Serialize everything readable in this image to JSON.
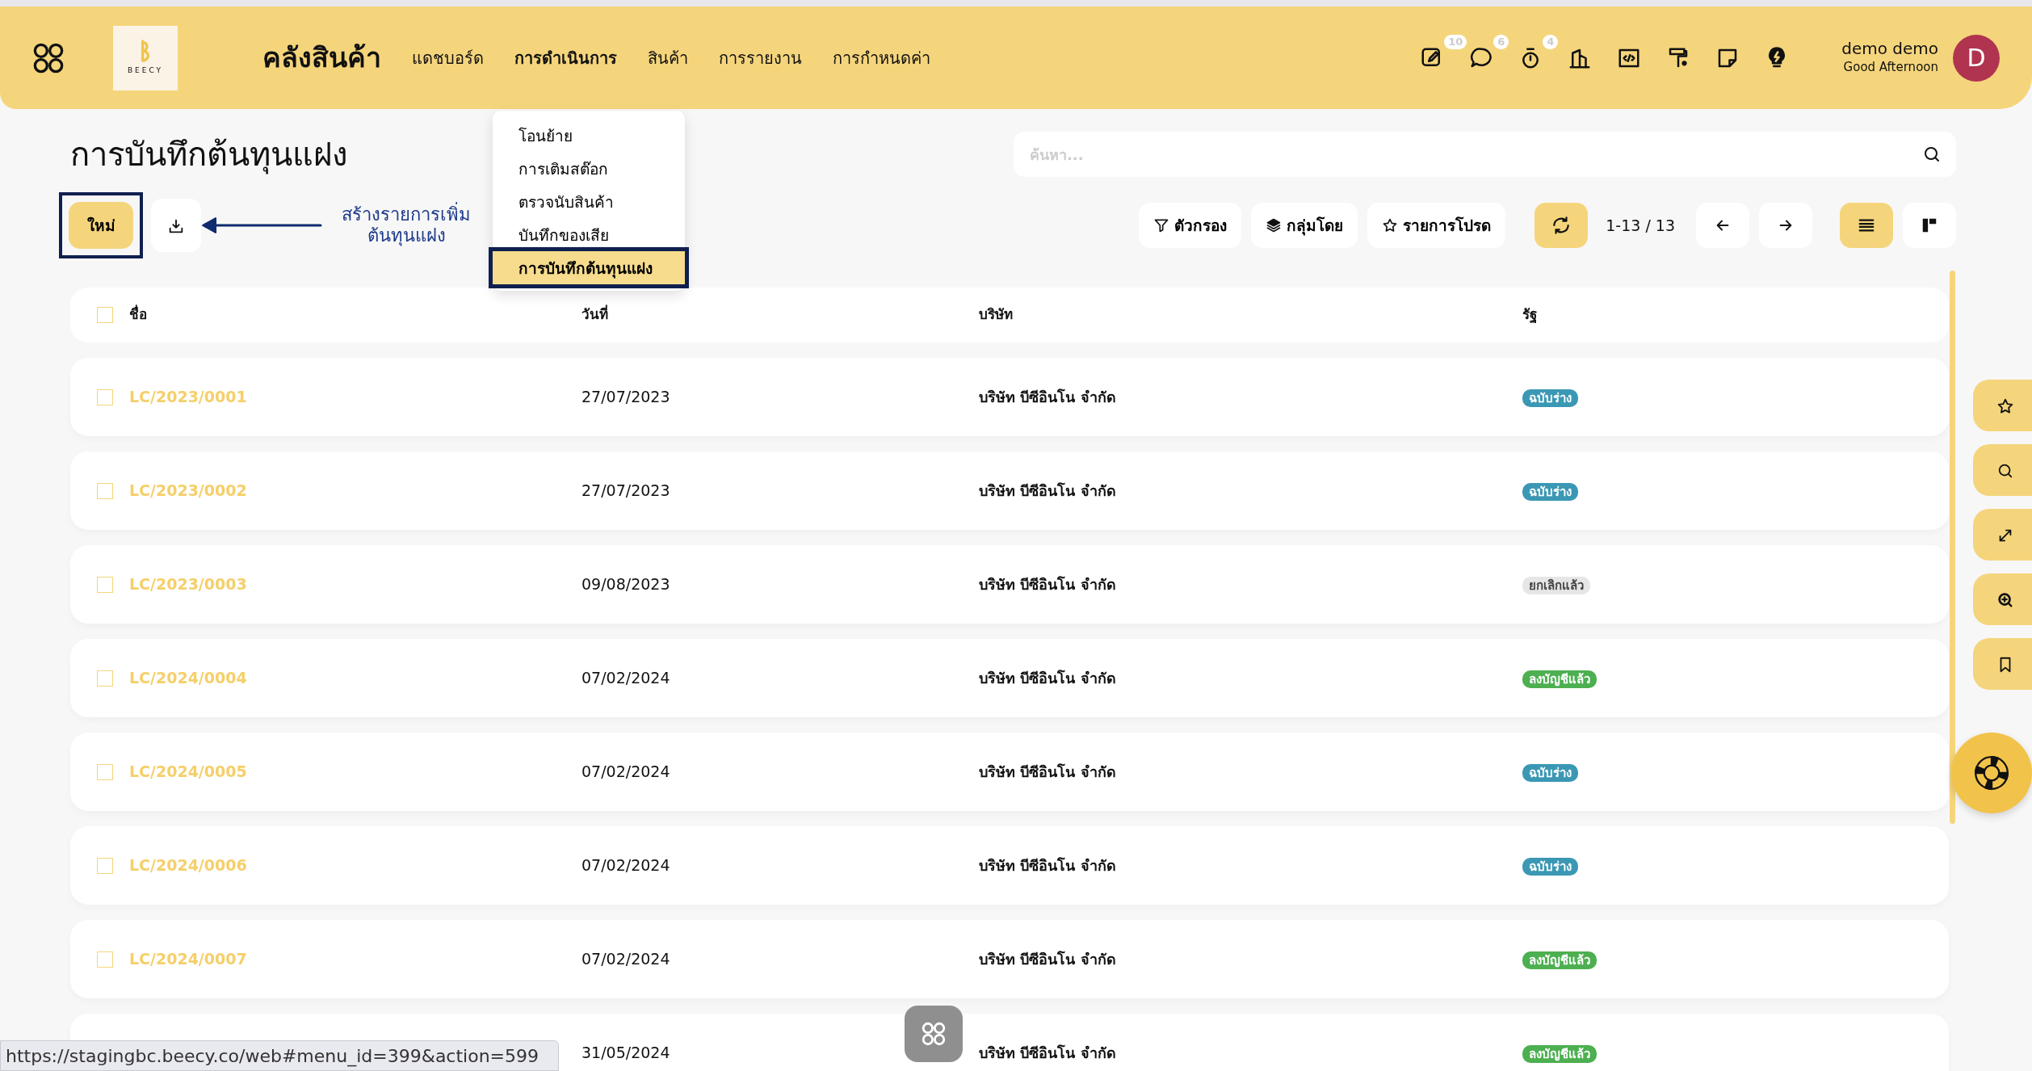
{
  "header": {
    "app_title": "คลังสินค้า",
    "logo_text": "BEECY",
    "menu": [
      {
        "label": "แดชบอร์ด",
        "open": false
      },
      {
        "label": "การดำเนินการ",
        "open": true
      },
      {
        "label": "สินค้า",
        "open": false
      },
      {
        "label": "การรายงาน",
        "open": false
      },
      {
        "label": "การกำหนดค่า",
        "open": false
      }
    ],
    "icons": [
      {
        "kind": "edit",
        "badge": "10"
      },
      {
        "kind": "chat",
        "badge": "6"
      },
      {
        "kind": "timer",
        "badge": "4"
      },
      {
        "kind": "building"
      },
      {
        "kind": "code"
      },
      {
        "kind": "roller"
      },
      {
        "kind": "note"
      },
      {
        "kind": "bulb"
      }
    ],
    "user": {
      "name": "demo demo",
      "greeting": "Good Afternoon",
      "initial": "D"
    }
  },
  "dropdown": [
    {
      "label": "โอนย้าย",
      "selected": false
    },
    {
      "label": "การเติมสต๊อก",
      "selected": false
    },
    {
      "label": "ตรวจนับสินค้า",
      "selected": false
    },
    {
      "label": "บันทึกของเสีย",
      "selected": false
    },
    {
      "label": "การบันทึกต้นทุนแฝง",
      "selected": true
    }
  ],
  "page_title": "การบันทึกต้นทุนแฝง",
  "new_button": "ใหม่",
  "annotation": "สร้างรายการเพิ่ม ต้นทุนแฝง",
  "search": {
    "placeholder": "ค้นหา..."
  },
  "toolbar": {
    "filter": "ตัวกรอง",
    "group_by": "กลุ่มโดย",
    "favorites": "รายการโปรด",
    "pager": "1-13 / 13"
  },
  "views": [
    {
      "kind": "list",
      "selected": true
    },
    {
      "kind": "kanban",
      "selected": false
    }
  ],
  "table": {
    "select_all_checked": false,
    "columns": [
      "ชื่อ",
      "วันที่",
      "บริษัท",
      "รัฐ"
    ],
    "rows": [
      {
        "checked": false,
        "name": "LC/2023/0001",
        "date": "27/07/2023",
        "company": "บริษัท บีซีอินโน จำกัด",
        "state": "ฉบับร่าง",
        "color": "#3b98b4"
      },
      {
        "checked": false,
        "name": "LC/2023/0002",
        "date": "27/07/2023",
        "company": "บริษัท บีซีอินโน จำกัด",
        "state": "ฉบับร่าง",
        "color": "#3b98b4"
      },
      {
        "checked": false,
        "name": "LC/2023/0003",
        "date": "09/08/2023",
        "company": "บริษัท บีซีอินโน จำกัด",
        "state": "ยกเลิกแล้ว",
        "color": "#e6e6e6"
      },
      {
        "checked": false,
        "name": "LC/2024/0004",
        "date": "07/02/2024",
        "company": "บริษัท บีซีอินโน จำกัด",
        "state": "ลงบัญชีแล้ว",
        "color": "#4caf50"
      },
      {
        "checked": false,
        "name": "LC/2024/0005",
        "date": "07/02/2024",
        "company": "บริษัท บีซีอินโน จำกัด",
        "state": "ฉบับร่าง",
        "color": "#3b98b4"
      },
      {
        "checked": false,
        "name": "LC/2024/0006",
        "date": "07/02/2024",
        "company": "บริษัท บีซีอินโน จำกัด",
        "state": "ฉบับร่าง",
        "color": "#3b98b4"
      },
      {
        "checked": false,
        "name": "LC/2024/0007",
        "date": "07/02/2024",
        "company": "บริษัท บีซีอินโน จำกัด",
        "state": "ลงบัญชีแล้ว",
        "color": "#4caf50"
      },
      {
        "date": "31/05/2024",
        "company": "บริษัท บีซีอินโน จำกัด",
        "state": "ลงบัญชีแล้ว",
        "color": "#4caf50"
      }
    ]
  },
  "side_tools": [
    {
      "kind": "star"
    },
    {
      "kind": "search"
    },
    {
      "kind": "expand"
    },
    {
      "kind": "zoom"
    },
    {
      "kind": "bookmark"
    }
  ],
  "status_url": "https://stagingbc.beecy.co/web#menu_id=399&action=599"
}
